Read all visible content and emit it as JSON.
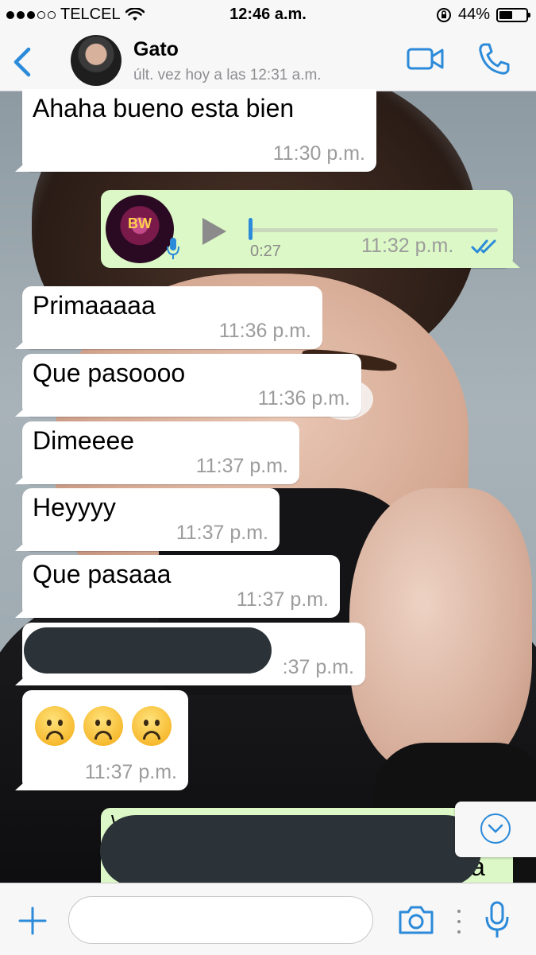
{
  "status_bar": {
    "carrier": "TELCEL",
    "time": "12:46 a.m.",
    "battery": "44%",
    "battery_level": 0.44
  },
  "header": {
    "contact_name": "Gato",
    "last_seen": "últ. vez hoy a las 12:31 a.m."
  },
  "messages": [
    {
      "direction": "in",
      "text": "Ahaha bueno esta bien",
      "time": "11:30 p.m."
    },
    {
      "direction": "out",
      "type": "voice",
      "avatar_text": "BW",
      "duration": "0:27",
      "time": "11:32 p.m.",
      "status": "read"
    },
    {
      "direction": "in",
      "text": "Primaaaaa",
      "time": "11:36 p.m."
    },
    {
      "direction": "in",
      "text": "Que pasoooo",
      "time": "11:36 p.m."
    },
    {
      "direction": "in",
      "text": "Dimeeee",
      "time": "11:37 p.m."
    },
    {
      "direction": "in",
      "text": "Heyyyy",
      "time": "11:37 p.m."
    },
    {
      "direction": "in",
      "text": "Que pasaaa",
      "time": "11:37 p.m."
    },
    {
      "direction": "in",
      "text": "",
      "time_partial": ":37 p.m.",
      "redacted": true
    },
    {
      "direction": "in",
      "type": "emoji",
      "emoji": "☹️☹️☹️",
      "time": "11:37 p.m."
    },
    {
      "direction": "out",
      "redacted": true,
      "visible_fragment_top": "\\",
      "visible_fragment_bottom": "a"
    }
  ],
  "input_bar": {
    "placeholder": ""
  },
  "icons": {
    "back": "chevron-left-icon",
    "video": "video-camera-icon",
    "call": "phone-icon",
    "plus": "plus-icon",
    "camera": "camera-icon",
    "mic": "microphone-icon",
    "scroll": "chevron-down-icon"
  },
  "colors": {
    "accent": "#2b8ad9",
    "outgoing_bubble": "#dcf8c6",
    "incoming_bubble": "#ffffff",
    "time_text": "#9c9c9c"
  }
}
